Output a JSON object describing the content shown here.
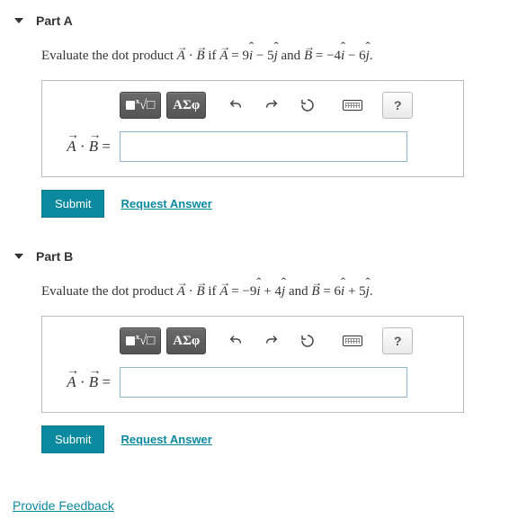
{
  "parts": [
    {
      "title": "Part A",
      "prompt_html": "Evaluate the dot product <span class='vec'>A</span> · <span class='vec'>B</span> if <span class='vec'>A</span> = 9<span class='hat'>i</span> − 5<span class='hat'>j</span> and <span class='vec'>B</span> = −4<span class='hat'>i</span> − 6<span class='hat'>j</span>.",
      "eq_label_html": "<span class='vec'>A</span> · <span class='vec'>B</span> =",
      "input_value": "",
      "submit": "Submit",
      "request": "Request Answer"
    },
    {
      "title": "Part B",
      "prompt_html": "Evaluate the dot product <span class='vec'>A</span> · <span class='vec'>B</span> if <span class='vec'>A</span> = −9<span class='hat'>i</span> + 4<span class='hat'>j</span> and <span class='vec'>B</span> = 6<span class='hat'>i</span> + 5<span class='hat'>j</span>.",
      "eq_label_html": "<span class='vec'>A</span> · <span class='vec'>B</span> =",
      "input_value": "",
      "submit": "Submit",
      "request": "Request Answer"
    }
  ],
  "toolbar": {
    "templates_label": "",
    "symbols_label": "ΑΣφ",
    "undo_title": "undo",
    "redo_title": "redo",
    "reset_title": "reset",
    "keyboard_title": "keyboard",
    "help_label": "?"
  },
  "feedback": "Provide Feedback"
}
